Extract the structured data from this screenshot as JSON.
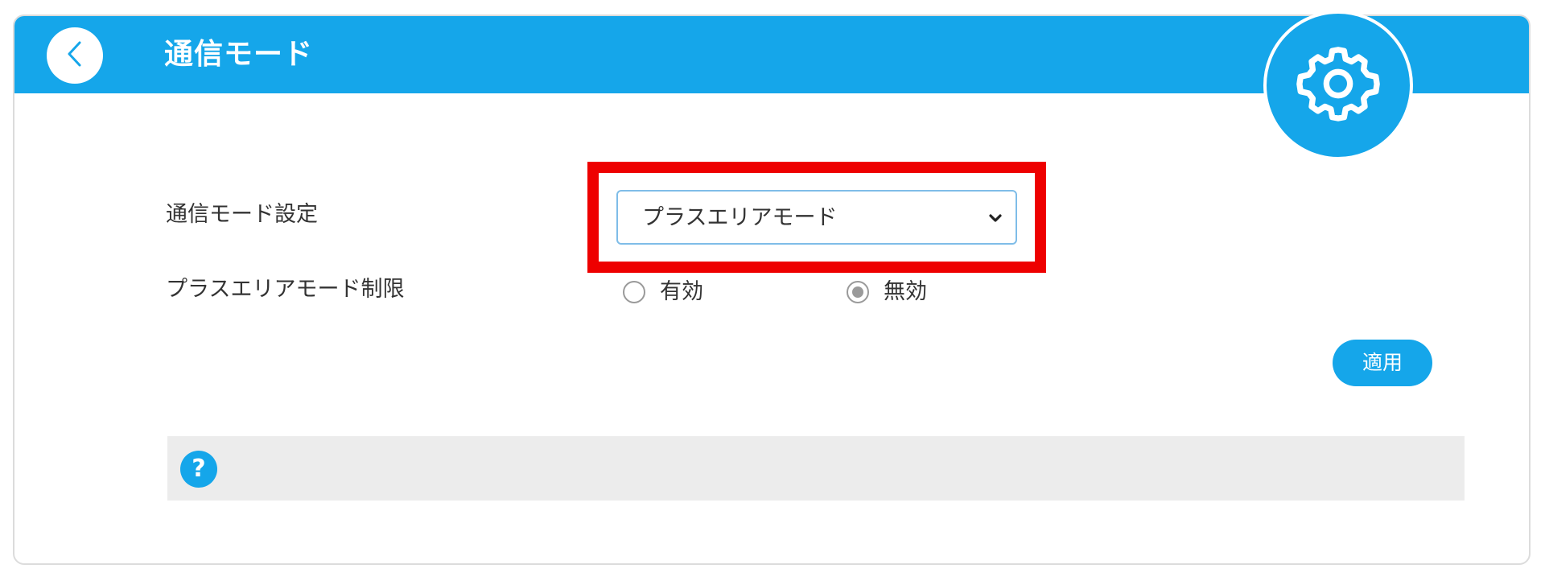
{
  "header": {
    "title": "通信モード"
  },
  "form": {
    "mode_label": "通信モード設定",
    "mode_select": {
      "value": "プラスエリアモード"
    },
    "limit_label": "プラスエリアモード制限",
    "limit_options": [
      {
        "label": "有効",
        "checked": false
      },
      {
        "label": "無効",
        "checked": true
      }
    ]
  },
  "actions": {
    "apply_label": "適用"
  },
  "help": {
    "icon_text": "?"
  },
  "colors": {
    "accent": "#15a6ea",
    "highlight": "#ee0000",
    "help_bar": "#ececec"
  },
  "icons": {
    "back": "chevron-left-icon",
    "settings": "gear-icon",
    "dropdown": "chevron-down-icon",
    "help": "question-icon"
  }
}
